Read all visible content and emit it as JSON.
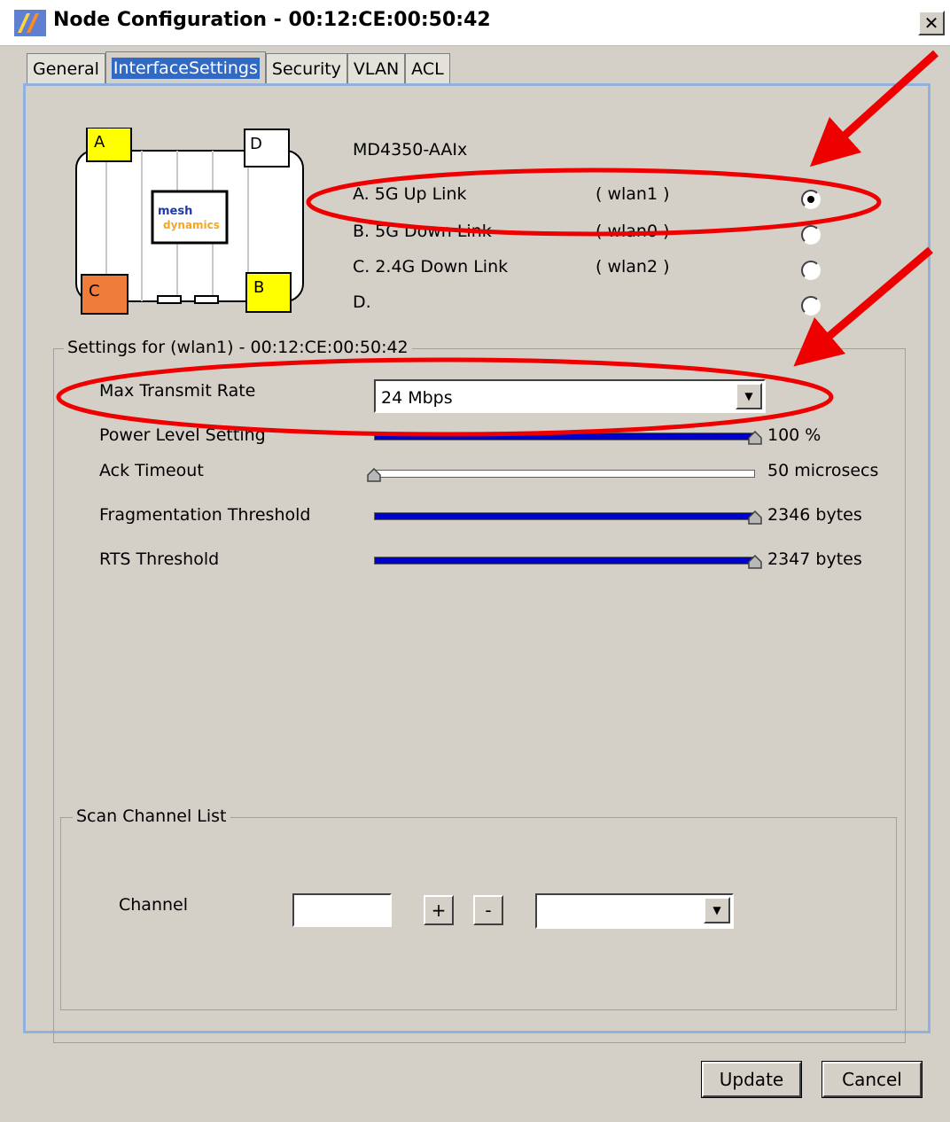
{
  "window": {
    "title": "Node Configuration - 00:12:CE:00:50:42",
    "close_icon": "close-icon"
  },
  "tabs": [
    {
      "label": "General",
      "active": false
    },
    {
      "label": "InterfaceSettings",
      "active": true
    },
    {
      "label": "Security",
      "active": false
    },
    {
      "label": "VLAN",
      "active": false
    },
    {
      "label": "ACL",
      "active": false
    }
  ],
  "device": {
    "logo_top": "mesh",
    "logo_bottom": "dynamics",
    "ports": [
      {
        "letter": "A",
        "color": "#ffff00"
      },
      {
        "letter": "D",
        "color": "#ffffff"
      },
      {
        "letter": "C",
        "color": "#f07c3c"
      },
      {
        "letter": "B",
        "color": "#ffff00"
      }
    ]
  },
  "interfaces": {
    "model": "MD4350-AAIx",
    "items": [
      {
        "label": "A. 5G  Up Link",
        "wlan": "( wlan1 )",
        "selected": true
      },
      {
        "label": "B. 5G  Down Link",
        "wlan": "( wlan0 )",
        "selected": false
      },
      {
        "label": "C. 2.4G  Down Link",
        "wlan": "( wlan2 )",
        "selected": false
      },
      {
        "label": "D.",
        "wlan": "",
        "selected": false
      }
    ]
  },
  "settings": {
    "legend": "Settings for (wlan1) - 00:12:CE:00:50:42",
    "max_transmit_rate": {
      "label": "Max Transmit Rate",
      "value": "24 Mbps"
    },
    "power_level": {
      "label": "Power Level Setting",
      "value_text": "100 %",
      "fraction": 1.0
    },
    "ack_timeout": {
      "label": "Ack Timeout",
      "value_text": "50 microsecs",
      "fraction": 0.0
    },
    "fragmentation": {
      "label": "Fragmentation Threshold",
      "value_text": "2346 bytes",
      "fraction": 1.0
    },
    "rts": {
      "label": "RTS Threshold",
      "value_text": "2347 bytes",
      "fraction": 1.0
    }
  },
  "scan": {
    "legend": "Scan Channel List",
    "channel_label": "Channel",
    "channel_value": "",
    "add_label": "+",
    "remove_label": "-",
    "channel_select_value": ""
  },
  "buttons": {
    "update": "Update",
    "cancel": "Cancel"
  },
  "colors": {
    "slider_fill": "#0000cc",
    "annotation": "#ee0000",
    "tab_active_bg": "#316ac5"
  }
}
